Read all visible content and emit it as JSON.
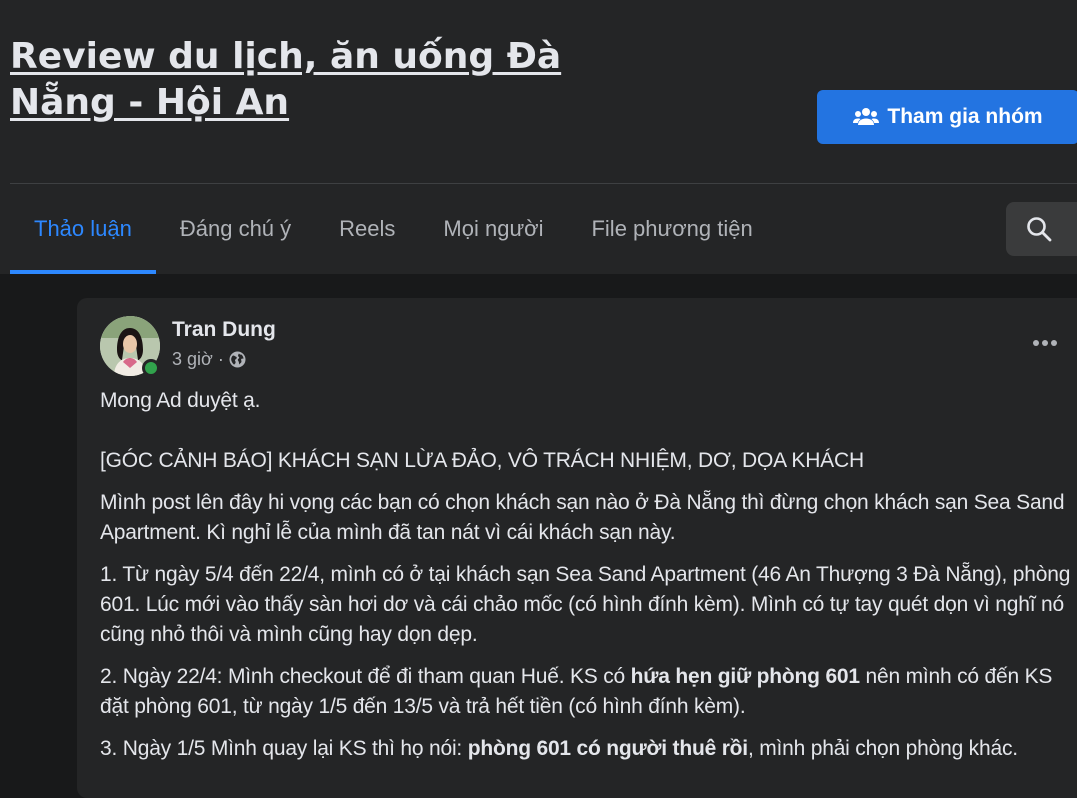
{
  "group": {
    "title": "Review du lịch, ăn uống Đà Nẵng - Hội An",
    "join_label": "Tham gia nhóm"
  },
  "tabs": [
    {
      "label": "Thảo luận",
      "active": true
    },
    {
      "label": "Đáng chú ý"
    },
    {
      "label": "Reels"
    },
    {
      "label": "Mọi người"
    },
    {
      "label": "File phương tiện"
    }
  ],
  "icons": {
    "join": "group-add-icon",
    "search": "search-icon",
    "audience": "globe-icon",
    "more": "more-options-icon"
  },
  "colors": {
    "accent": "#2d88ff",
    "button": "#2374e1",
    "online": "#31a24c"
  },
  "post": {
    "author": "Tran Dung",
    "time": "3 giờ",
    "separator": "·",
    "line1": "Mong Ad duyệt ạ.",
    "line2": "[GÓC CẢNH BÁO] KHÁCH SẠN LỪA ĐẢO, VÔ TRÁCH NHIỆM, DƠ, DỌA KHÁCH",
    "para1": "Mình post lên đây hi vọng các bạn có chọn khách sạn nào ở Đà Nẵng thì đừng chọn khách sạn Sea Sand Apartment. Kì nghỉ lễ của mình đã tan nát vì cái khách sạn này.",
    "para2": "1. Từ ngày 5/4 đến 22/4, mình có ở tại khách sạn Sea Sand Apartment (46 An Thượng 3 Đà Nẵng), phòng 601. Lúc mới vào thấy sàn hơi dơ và cái chảo mốc (có hình đính kèm). Mình có tự tay quét dọn vì nghĩ nó cũng nhỏ thôi và mình cũng hay dọn dẹp.",
    "para3_a": "2. Ngày 22/4: Mình checkout để đi tham quan Huế. KS có ",
    "para3_b": "hứa hẹn giữ phòng 601",
    "para3_c": " nên mình có đến KS đặt phòng 601, từ ngày 1/5 đến 13/5 và trả hết tiền (có hình đính kèm).",
    "para4_a": "3. Ngày 1/5 Mình quay lại KS thì họ nói: ",
    "para4_b": "phòng 601 có người thuê rồi",
    "para4_c": ", mình phải chọn phòng khác."
  }
}
